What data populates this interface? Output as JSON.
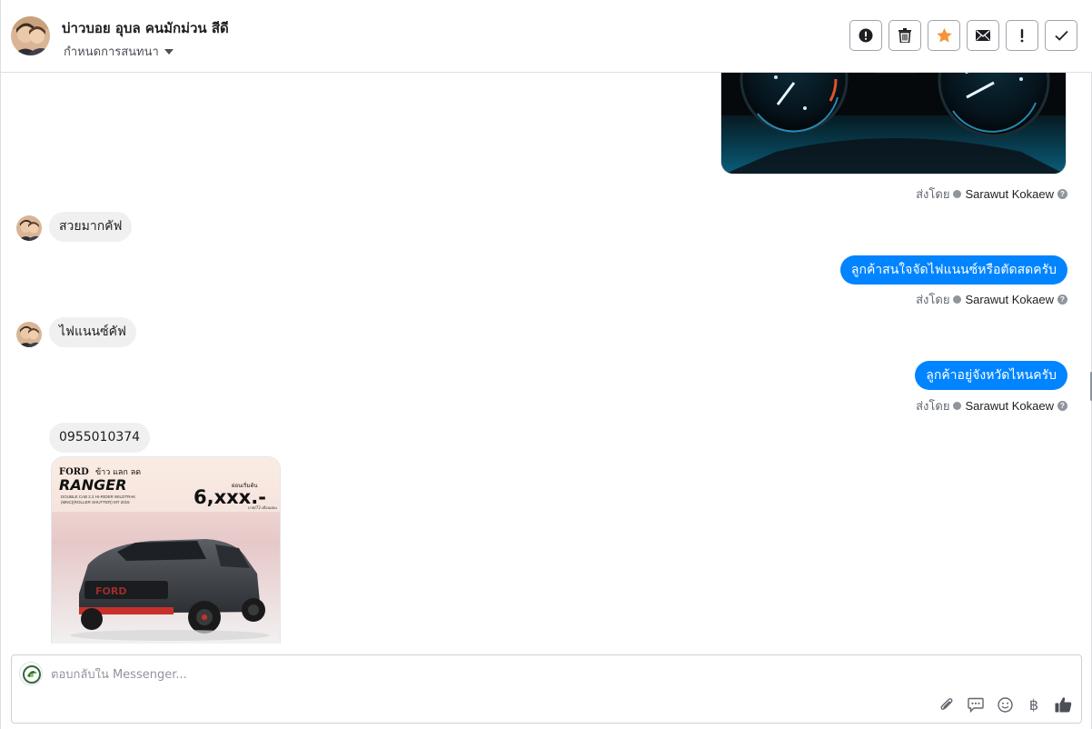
{
  "header": {
    "contact_name": "บ่าวบอย อุบล คนมักม่วน สีดี",
    "assign_label": "กำหนดการสนทนา",
    "actions": [
      {
        "name": "spam",
        "icon": "alert-circle-icon"
      },
      {
        "name": "delete",
        "icon": "trash-icon"
      },
      {
        "name": "star",
        "icon": "star-icon"
      },
      {
        "name": "mark-unread",
        "icon": "envelope-icon"
      },
      {
        "name": "follow-up",
        "icon": "exclamation-icon"
      },
      {
        "name": "done",
        "icon": "check-icon"
      }
    ],
    "star_color": "#f7923b"
  },
  "thread": {
    "sent_by_prefix": "ส่งโดย",
    "sent_by_name": "Sarawut Kokaew",
    "messages": [
      {
        "direction": "out",
        "type": "image",
        "alt": "car dashboard gauges"
      },
      {
        "direction": "in",
        "text": "สวยมากคัฟ"
      },
      {
        "direction": "out",
        "text": "ลูกค้าสนใจจัดไฟแนนซ์หรือตัดสดครับ"
      },
      {
        "direction": "in",
        "text": "ไฟแนนซ์คัฟ"
      },
      {
        "direction": "out",
        "text": "ลูกค้าอยู่จังหวัดไหนครับ"
      },
      {
        "direction": "in",
        "text": "0955010374"
      },
      {
        "direction": "in",
        "type": "image",
        "ad": {
          "brand": "FORD",
          "brand_thai": "ข้าว แลก ลด",
          "model": "RANGER",
          "desc1": "DOUBLE CAB 2.2 HI-RIDER WILDTRAK",
          "desc2": "(MNC)(ROLLER SHUTTER) MT 2015",
          "price_label": "ผ่อนเริ่มต้น",
          "price": "6,xxx.-",
          "price_note": "บาท/72 เดือนผ่อน"
        }
      }
    ],
    "bubble_out_color": "#0084ff",
    "bubble_in_color": "#f0f0f0"
  },
  "composer": {
    "placeholder": "ตอบกลับใน Messenger...",
    "tools": [
      "paperclip-icon",
      "saved-reply-icon",
      "emoji-icon",
      "baht-icon",
      "thumbs-up-icon"
    ],
    "baht_glyph": "฿"
  }
}
